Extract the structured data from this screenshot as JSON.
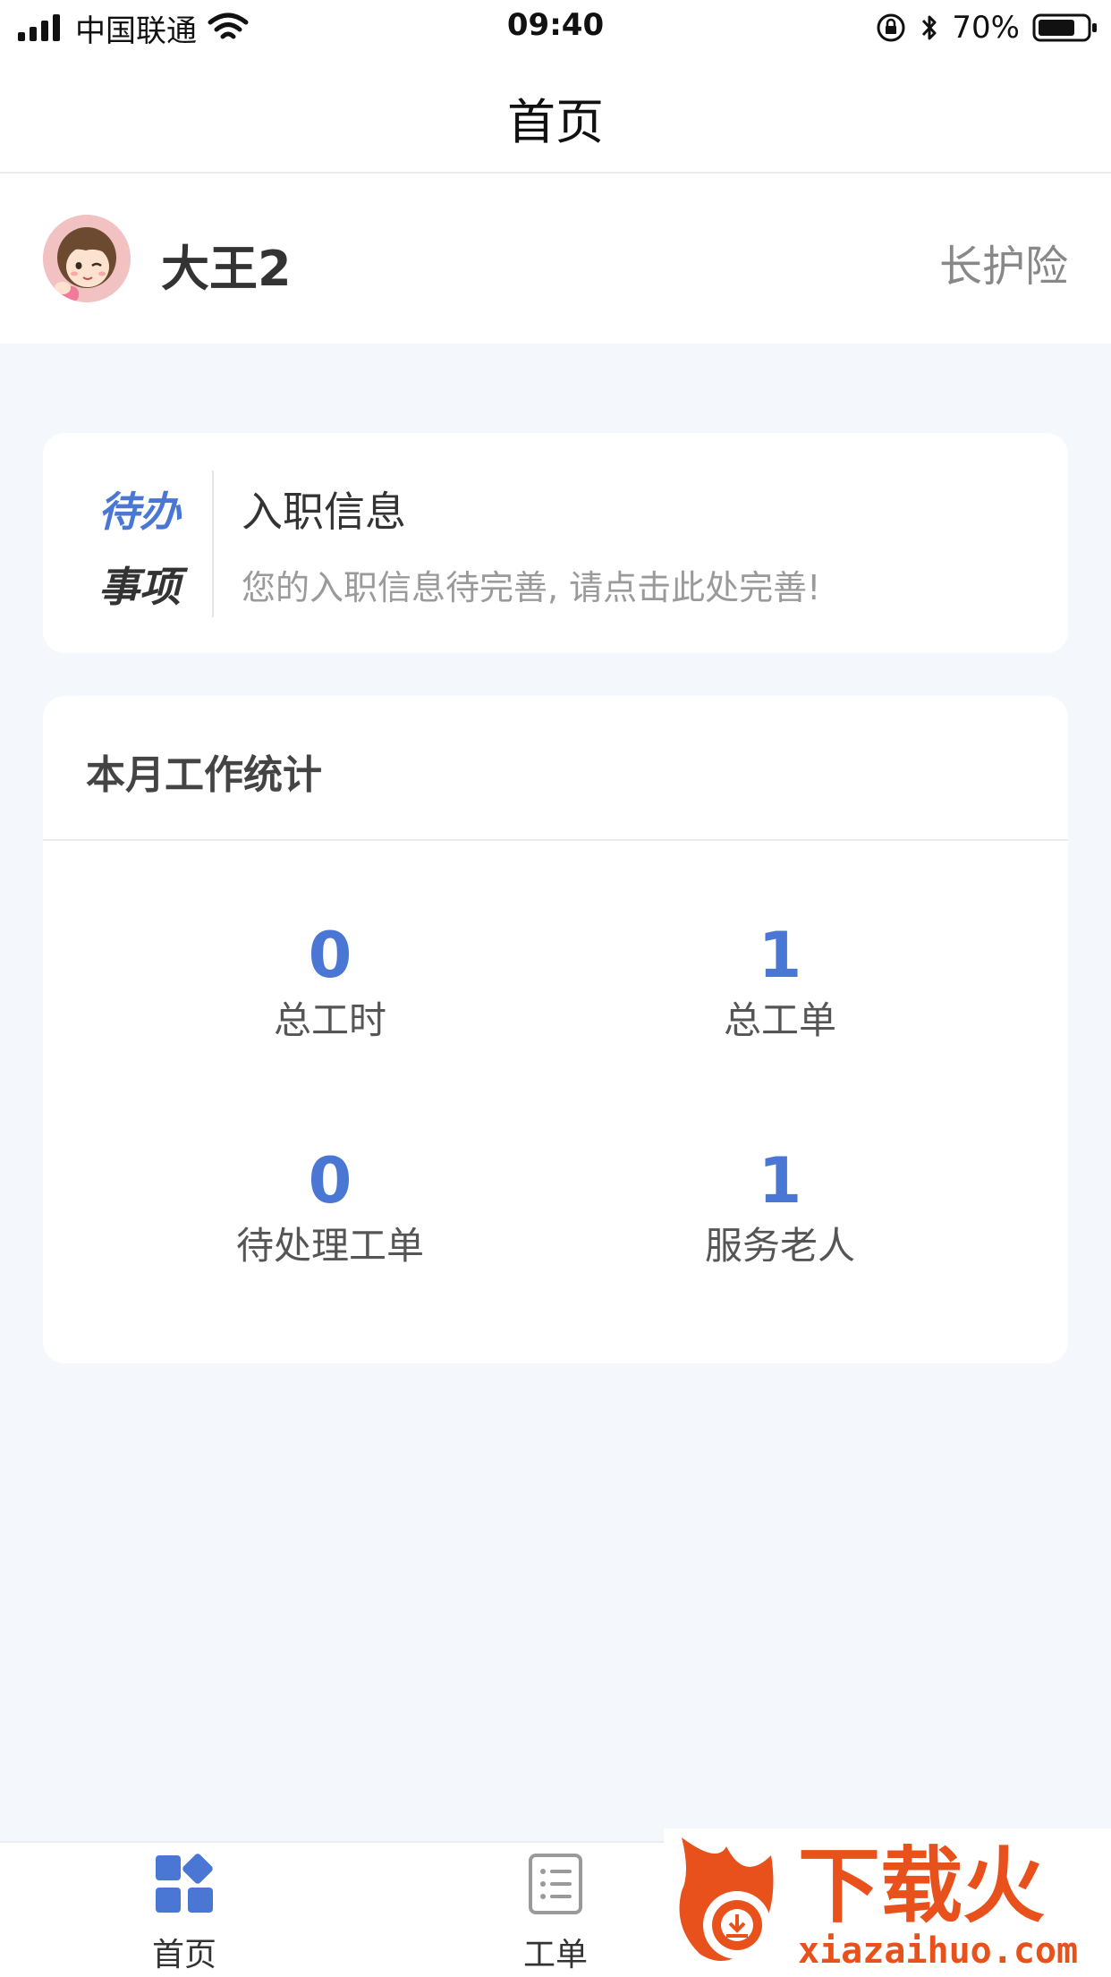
{
  "status_bar": {
    "carrier": "中国联通",
    "time": "09:40",
    "battery": "70%"
  },
  "header": {
    "title": "首页"
  },
  "user": {
    "name": "大王2",
    "insurance_link": "长护险"
  },
  "todo": {
    "label_line1": "待办",
    "label_line2": "事项",
    "title": "入职信息",
    "description": "您的入职信息待完善, 请点击此处完善!"
  },
  "stats": {
    "title": "本月工作统计",
    "items": [
      {
        "value": "0",
        "label": "总工时"
      },
      {
        "value": "1",
        "label": "总工单"
      },
      {
        "value": "0",
        "label": "待处理工单"
      },
      {
        "value": "1",
        "label": "服务老人"
      }
    ]
  },
  "tabs": [
    {
      "label": "首页",
      "icon": "grid-icon",
      "active": true
    },
    {
      "label": "工单",
      "icon": "list-icon",
      "active": false
    }
  ],
  "watermark": {
    "brand": "下载火",
    "url": "xiazaihuo.com"
  },
  "colors": {
    "accent": "#4a77d4",
    "background": "#f4f7fb",
    "watermark": "#e8511c"
  }
}
